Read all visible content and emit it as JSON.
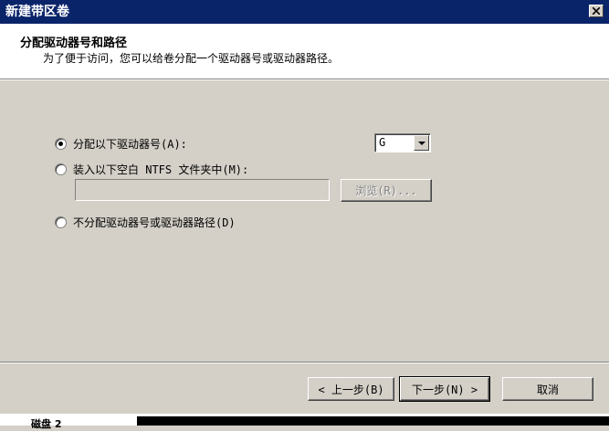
{
  "window": {
    "title": "新建带区卷",
    "close_glyph": "✕"
  },
  "header": {
    "title": "分配驱动器号和路径",
    "subtitle": "为了便于访问，您可以给卷分配一个驱动器号或驱动器路径。"
  },
  "options": {
    "assign_letter": {
      "label": "分配以下驱动器号(A):",
      "checked": true
    },
    "mount_folder": {
      "label": "装入以下空白 NTFS 文件夹中(M):",
      "checked": false
    },
    "no_assign": {
      "label": "不分配驱动器号或驱动器路径(D)",
      "checked": false
    }
  },
  "drive_letter": {
    "value": "G"
  },
  "folder_path": {
    "value": ""
  },
  "buttons": {
    "browse": "浏览(R)...",
    "back": "< 上一步(B)",
    "next": "下一步(N) >",
    "cancel": "取消"
  },
  "background_window": {
    "label": "磁盘 2"
  },
  "colors": {
    "title_bar": "#0a246a",
    "face": "#d4d0c8"
  }
}
